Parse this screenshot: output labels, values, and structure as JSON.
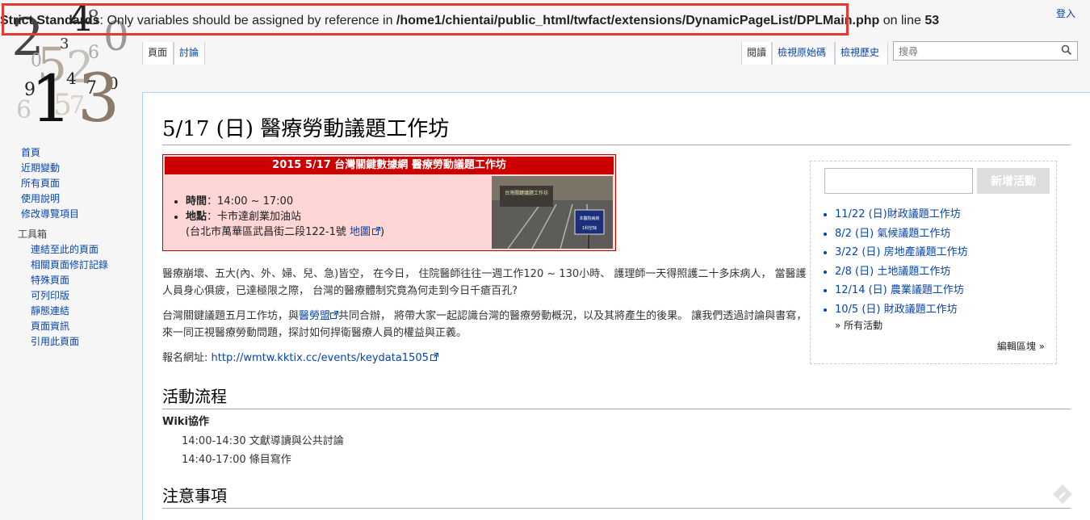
{
  "error": {
    "label": "Strict Standards",
    "message": ": Only variables should be assigned by reference in ",
    "path": "/home1/chientai/public_html/twfact/extensions/DynamicPageList/DPLMain.php",
    "on_line": " on line ",
    "line": "53"
  },
  "header": {
    "login": "登入"
  },
  "tabs": {
    "page": "頁面",
    "talk": "討論",
    "read": "閱讀",
    "edit": "檢視原始碼",
    "history": "檢視歷史"
  },
  "search": {
    "placeholder": "搜尋"
  },
  "sidebar": {
    "nav": [
      "首頁",
      "近期變動",
      "所有頁面",
      "使用說明",
      "修改導覽項目"
    ],
    "tools_heading": "工具箱",
    "tools": [
      "連結至此的頁面",
      "相關頁面修訂記錄",
      "特殊頁面",
      "可列印版",
      "靜態連結",
      "頁面資訊",
      "引用此頁面"
    ]
  },
  "page": {
    "title": "5/17 (日) 醫療勞動議題工作坊",
    "infobox": {
      "header": "2015 5/17 台灣關鍵數據網 醫療勞動議題工作坊",
      "time_label": "時間",
      "time_value": "：14:00 ~ 17:00",
      "place_label": "地點",
      "place_value": "：卡市達創業加油站",
      "address": "(台北市萬華區武昌街二段122-1號 ",
      "map_link": "地圖",
      "address_close": ")"
    },
    "paragraph1": "醫療崩壞、五大(內、外、婦、兒、急)皆空， 在今日， 住院醫師往往一週工作120 ~ 130小時、 護理師一天得照護二十多床病人， 當醫護人員身心俱疲，已達極限之際， 台灣的醫療體制究竟為何走到今日千瘡百孔?",
    "paragraph2_a": "台灣關鍵議題五月工作坊，與",
    "paragraph2_link": "醫勞盟",
    "paragraph2_b": "共同合辦， 將帶大家一起認識台灣的醫療勞動概況，以及其將產生的後果。 讓我們透過討論與書寫，來一同正視醫療勞動問題，探討如何捍衛醫療人員的權益與正義。",
    "register_label": "報名網址: ",
    "register_url": "http://wmtw.kktix.cc/events/keydata1505",
    "section1": "活動流程",
    "wiki_collab": "Wiki協作",
    "schedule": [
      "14:00-14:30 文獻導讀與公共討論",
      "14:40-17:00 條目寫作"
    ],
    "section2": "注意事項"
  },
  "events_box": {
    "add_button": "新增活動",
    "items": [
      "11/22 (日)財政議題工作坊",
      "8/2 (日) 氣候議題工作坊",
      "3/22 (日) 房地產議題工作坊",
      "2/8 (日) 土地議題工作坊",
      "12/14 (日) 農業議題工作坊",
      "10/5 (日) 財政議題工作坊"
    ],
    "all_events": "» 所有活動",
    "edit_region": "編輯區塊 »"
  },
  "photo_sign": {
    "line1": "本醫院病房",
    "line2": "1科空缺",
    "banner": "台灣關鍵議題工作坊"
  },
  "logo_digits": [
    "2",
    "4",
    "0",
    "8",
    "3",
    "5",
    "2",
    "0",
    "6",
    "1",
    "4",
    "7",
    "0",
    "9",
    "5",
    "3",
    "6",
    "7"
  ]
}
